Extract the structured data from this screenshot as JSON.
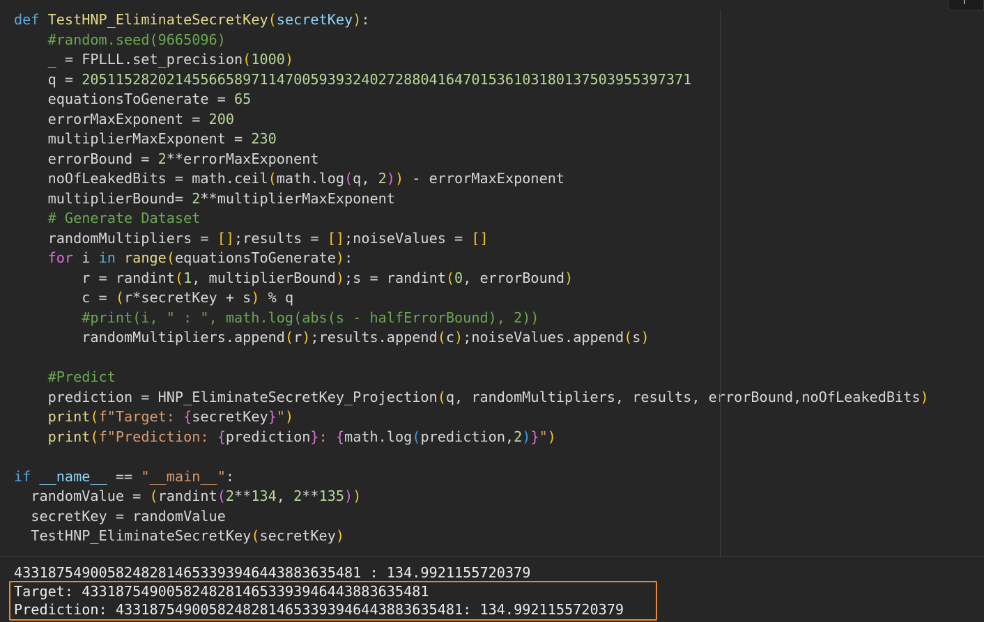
{
  "code": {
    "lines": [
      [
        {
          "t": "def ",
          "c": "kw"
        },
        {
          "t": "TestHNP_EliminateSecretKey",
          "c": "fn"
        },
        {
          "t": "(",
          "c": "br"
        },
        {
          "t": "secretKey",
          "c": "pm"
        },
        {
          "t": ")",
          "c": "br"
        },
        {
          "t": ":",
          "c": ""
        }
      ],
      [
        {
          "t": "    ",
          "c": ""
        },
        {
          "t": "#random.seed(9665096)",
          "c": "cm"
        }
      ],
      [
        {
          "t": "    _ = FPLLL.set_precision",
          "c": ""
        },
        {
          "t": "(",
          "c": "br"
        },
        {
          "t": "1000",
          "c": "num"
        },
        {
          "t": ")",
          "c": "br"
        }
      ],
      [
        {
          "t": "    q = ",
          "c": ""
        },
        {
          "t": "205115282021455665897114700593932402728804164701536103180137503955397371",
          "c": "num"
        }
      ],
      [
        {
          "t": "    equationsToGenerate = ",
          "c": ""
        },
        {
          "t": "65",
          "c": "num"
        }
      ],
      [
        {
          "t": "    errorMaxExponent = ",
          "c": ""
        },
        {
          "t": "200",
          "c": "num"
        }
      ],
      [
        {
          "t": "    multiplierMaxExponent = ",
          "c": ""
        },
        {
          "t": "230",
          "c": "num"
        }
      ],
      [
        {
          "t": "    errorBound = ",
          "c": ""
        },
        {
          "t": "2",
          "c": "num"
        },
        {
          "t": "**errorMaxExponent",
          "c": ""
        }
      ],
      [
        {
          "t": "    noOfLeakedBits = math.ceil",
          "c": ""
        },
        {
          "t": "(",
          "c": "br"
        },
        {
          "t": "math.log",
          "c": ""
        },
        {
          "t": "(",
          "c": "br2"
        },
        {
          "t": "q, ",
          "c": ""
        },
        {
          "t": "2",
          "c": "num"
        },
        {
          "t": ")",
          "c": "br2"
        },
        {
          "t": ")",
          "c": "br"
        },
        {
          "t": " - errorMaxExponent",
          "c": ""
        }
      ],
      [
        {
          "t": "    multiplierBound= ",
          "c": ""
        },
        {
          "t": "2",
          "c": "num"
        },
        {
          "t": "**multiplierMaxExponent",
          "c": ""
        }
      ],
      [
        {
          "t": "    ",
          "c": ""
        },
        {
          "t": "# Generate Dataset",
          "c": "cm"
        }
      ],
      [
        {
          "t": "    randomMultipliers = ",
          "c": ""
        },
        {
          "t": "[]",
          "c": "br"
        },
        {
          "t": ";results = ",
          "c": ""
        },
        {
          "t": "[]",
          "c": "br"
        },
        {
          "t": ";noiseValues = ",
          "c": ""
        },
        {
          "t": "[]",
          "c": "br"
        }
      ],
      [
        {
          "t": "    ",
          "c": ""
        },
        {
          "t": "for",
          "c": "mg"
        },
        {
          "t": " i ",
          "c": ""
        },
        {
          "t": "in",
          "c": "kw"
        },
        {
          "t": " ",
          "c": ""
        },
        {
          "t": "range",
          "c": "fn"
        },
        {
          "t": "(",
          "c": "br"
        },
        {
          "t": "equationsToGenerate",
          "c": ""
        },
        {
          "t": ")",
          "c": "br"
        },
        {
          "t": ":",
          "c": ""
        }
      ],
      [
        {
          "t": "        r = randint",
          "c": ""
        },
        {
          "t": "(",
          "c": "br"
        },
        {
          "t": "1",
          "c": "num"
        },
        {
          "t": ", multiplierBound",
          "c": ""
        },
        {
          "t": ")",
          "c": "br"
        },
        {
          "t": ";s = randint",
          "c": ""
        },
        {
          "t": "(",
          "c": "br"
        },
        {
          "t": "0",
          "c": "num"
        },
        {
          "t": ", errorBound",
          "c": ""
        },
        {
          "t": ")",
          "c": "br"
        }
      ],
      [
        {
          "t": "        c = ",
          "c": ""
        },
        {
          "t": "(",
          "c": "br"
        },
        {
          "t": "r*secretKey + s",
          "c": ""
        },
        {
          "t": ")",
          "c": "br"
        },
        {
          "t": " % q",
          "c": ""
        }
      ],
      [
        {
          "t": "        ",
          "c": ""
        },
        {
          "t": "#print(i, \" : \", math.log(abs(s - halfErrorBound), 2))",
          "c": "cmt"
        }
      ],
      [
        {
          "t": "        randomMultipliers.append",
          "c": ""
        },
        {
          "t": "(",
          "c": "br"
        },
        {
          "t": "r",
          "c": ""
        },
        {
          "t": ")",
          "c": "br"
        },
        {
          "t": ";results.append",
          "c": ""
        },
        {
          "t": "(",
          "c": "br"
        },
        {
          "t": "c",
          "c": ""
        },
        {
          "t": ")",
          "c": "br"
        },
        {
          "t": ";noiseValues.append",
          "c": ""
        },
        {
          "t": "(",
          "c": "br"
        },
        {
          "t": "s",
          "c": ""
        },
        {
          "t": ")",
          "c": "br"
        }
      ],
      [
        {
          "t": " ",
          "c": ""
        }
      ],
      [
        {
          "t": "    ",
          "c": ""
        },
        {
          "t": "#Predict",
          "c": "cm"
        }
      ],
      [
        {
          "t": "    prediction = HNP_EliminateSecretKey_Projection",
          "c": ""
        },
        {
          "t": "(",
          "c": "br"
        },
        {
          "t": "q, randomMultipliers, results, errorBound,noOfLeakedBits",
          "c": ""
        },
        {
          "t": ")",
          "c": "br"
        }
      ],
      [
        {
          "t": "    ",
          "c": ""
        },
        {
          "t": "print",
          "c": "fn"
        },
        {
          "t": "(",
          "c": "br"
        },
        {
          "t": "f\"Target: ",
          "c": "str"
        },
        {
          "t": "{",
          "c": "br2"
        },
        {
          "t": "secretKey",
          "c": ""
        },
        {
          "t": "}",
          "c": "br2"
        },
        {
          "t": "\"",
          "c": "str"
        },
        {
          "t": ")",
          "c": "br"
        }
      ],
      [
        {
          "t": "    ",
          "c": ""
        },
        {
          "t": "print",
          "c": "fn"
        },
        {
          "t": "(",
          "c": "br"
        },
        {
          "t": "f\"Prediction: ",
          "c": "str"
        },
        {
          "t": "{",
          "c": "br2"
        },
        {
          "t": "prediction",
          "c": ""
        },
        {
          "t": "}",
          "c": "br2"
        },
        {
          "t": ": ",
          "c": "str"
        },
        {
          "t": "{",
          "c": "br2"
        },
        {
          "t": "math.log",
          "c": ""
        },
        {
          "t": "(",
          "c": "br3"
        },
        {
          "t": "prediction,",
          "c": ""
        },
        {
          "t": "2",
          "c": "num"
        },
        {
          "t": ")",
          "c": "br3"
        },
        {
          "t": "}",
          "c": "br2"
        },
        {
          "t": "\"",
          "c": "str"
        },
        {
          "t": ")",
          "c": "br"
        }
      ],
      [
        {
          "t": " ",
          "c": ""
        }
      ],
      [
        {
          "t": "if",
          "c": "kw"
        },
        {
          "t": " ",
          "c": ""
        },
        {
          "t": "__name__",
          "c": "pm"
        },
        {
          "t": " == ",
          "c": ""
        },
        {
          "t": "\"__main__\"",
          "c": "str"
        },
        {
          "t": ":",
          "c": ""
        }
      ],
      [
        {
          "t": "  randomValue = ",
          "c": ""
        },
        {
          "t": "(",
          "c": "br"
        },
        {
          "t": "randint",
          "c": ""
        },
        {
          "t": "(",
          "c": "br2"
        },
        {
          "t": "2",
          "c": "num"
        },
        {
          "t": "**",
          "c": ""
        },
        {
          "t": "134",
          "c": "num"
        },
        {
          "t": ", ",
          "c": ""
        },
        {
          "t": "2",
          "c": "num"
        },
        {
          "t": "**",
          "c": ""
        },
        {
          "t": "135",
          "c": "num"
        },
        {
          "t": ")",
          "c": "br2"
        },
        {
          "t": ")",
          "c": "br"
        }
      ],
      [
        {
          "t": "  secretKey = randomValue",
          "c": ""
        }
      ],
      [
        {
          "t": "  TestHNP_EliminateSecretKey",
          "c": ""
        },
        {
          "t": "(",
          "c": "br"
        },
        {
          "t": "secretKey",
          "c": ""
        },
        {
          "t": ")",
          "c": "br"
        }
      ]
    ]
  },
  "output": {
    "line1": "43318754900582482814653393946443883635481 : 134.9921155720379",
    "line2": "Target: 43318754900582482814653393946443883635481",
    "line3": "Prediction: 43318754900582482814653393946443883635481: 134.9921155720379"
  },
  "colors": {
    "background": "#262626",
    "highlight_border": "#f08a24"
  }
}
